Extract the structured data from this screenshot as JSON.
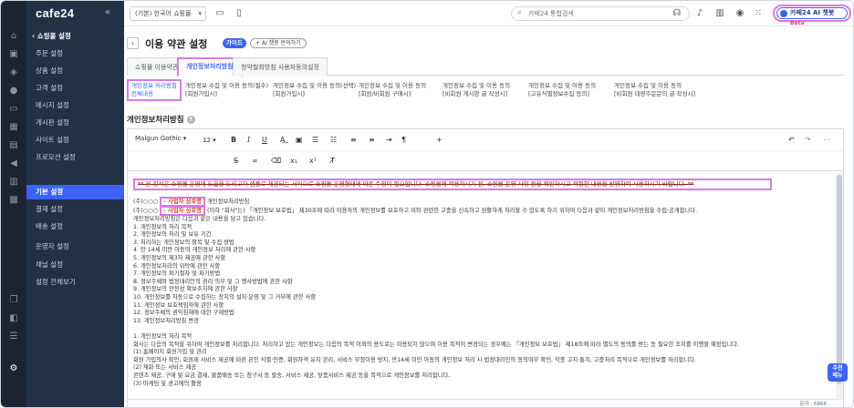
{
  "brand": {
    "logo": "cafe24",
    "collapse": "«"
  },
  "rail": {
    "icons": [
      "home-icon",
      "box-icon",
      "tag-icon",
      "user-icon",
      "message-icon",
      "grid-icon",
      "monitor-icon",
      "megaphone-icon",
      "chart-icon",
      "apps-icon",
      "layers-icon",
      "puzzle-icon",
      "list-icon",
      "gear-icon"
    ]
  },
  "menu": {
    "back": "‹ 쇼핑몰 설정",
    "items": [
      "주문 설정",
      "상품 설정",
      "고객 설정",
      "메시지 설정",
      "게시판 설정",
      "사이트 설정",
      "프로모션 설정",
      "기본 설정",
      "결제 설정",
      "배송 설정",
      "운영자 설정",
      "채널 설정",
      "설정 전체보기"
    ],
    "active_index": 7
  },
  "topbar": {
    "shop_select": "(기본) 한국어 쇼핑몰",
    "search_placeholder": "카페24 통합검색",
    "ai_label": "카페24 AI 챗봇",
    "ai_beta": "Beta"
  },
  "page": {
    "title": "이용 약관 설정",
    "guide": "가이드",
    "ask": "+ AI 챗봇 문의하기"
  },
  "tabs": [
    "쇼핑몰 이용약관",
    "개인정보처리방침",
    "청약철회방침 사용자동의설정"
  ],
  "subnav": [
    [
      "개인정보 처리방침",
      "전체내용"
    ],
    [
      "개인정보 수집 및 이용 동의(필수)",
      "[회원가입시]"
    ],
    [
      "개인정보 수집 및 이용 동의(선택)",
      "[회원가입시]"
    ],
    [
      "개인정보 수집 및 이용 동의",
      "[회원/비회원 구매시]"
    ],
    [
      "개인정보 수집 및 이용 동의",
      "[비회원 게시판 글 작성시]"
    ],
    [
      "개인정보 수집 및 이용 동의",
      "[고유식별정보수집 동의]"
    ],
    [
      "개인정보 수집 및 이용 동의",
      "[비회원 대량주문문의 글 작성시]"
    ]
  ],
  "section_title": "개인정보처리방침",
  "editor": {
    "font": "Malgun Gothic",
    "size": "12",
    "notice": "** 본 양식은 쇼핑몰 운영에 도움을 드리고자 샘플로 제공되는 서식으로 쇼핑몰 운영형태에 따른 수정이 필요합니다. 쇼핑몰에 적용하시기 전, 쇼핑몰 운영 사항 등을 확인하시고 적절한 내용을 반영하여 사용하시기 바랍니다. **",
    "pill_text": "- 사업자 상호명",
    "line1_prefix": "(주)○○○",
    "line1_suffix": "개인정보처리방침",
    "line2_prefix": "(주)○○○",
    "line2_suffix": "(이하 \"회사\"는) 「개인정보 보호법」 제30조에 따라 이용자의 개인정보를 보호하고 이와 관련한 고충을 신속하고 원활하게 처리할 수 있도록 하기 위하여 다음과 같이 개인정보처리방침을 수립·공개합니다.",
    "lines": [
      "개인정보처리방침은 다음과 같은 내용을 담고 있습니다.",
      "1. 개인정보의 처리 목적",
      "2. 개인정보의 처리 및 보유 기간",
      "3. 처리하는 개인정보의 항목 및 수집 방법",
      "4. 만 14세 미만 아동의 개인정보 처리에 관한 사항",
      "5. 개인정보의 제3자 제공에 관한 사항",
      "6. 개인정보처리의 위탁에 관한 사항",
      "7. 개인정보의 파기절차 및 파기방법",
      "8. 정보주체와 법정대리인의 권리·의무 및 그 행사방법에 관한 사항",
      "9. 개인정보의 안전성 확보조치에 관한 사항",
      "10. 개인정보를 자동으로 수집하는 장치의 설치·운영 및 그 거부에 관한 사항",
      "11. 개인정보 보호책임자에 관한 사항",
      "12. 정보주체의 권익침해에 대한 구제방법",
      "13. 개인정보처리방침 변경",
      "",
      "1. 개인정보의 처리 목적",
      "회사는 다음의 목적을 위하여 개인정보를 처리합니다. 처리하고 있는 개인정보는 다음의 목적 이외의 용도로는 이용되지 않으며 이용 목적이 변경되는 경우에는 「개인정보 보호법」 제18조에 따라 별도의 동의를 받는 등 필요한 조치를 이행할 예정입니다.",
      "(1) 홈페이지 회원가입 및 관리",
      "회원 가입의사 확인, 회원제 서비스 제공에 따른 본인 식별·인증, 회원자격 유지·관리, 서비스 부정이용 방지, 만14세 미만 아동의 개인정보 처리 시 법정대리인의 동의여부 확인, 각종 고지·통지, 고충처리 목적으로 개인정보를 처리합니다.",
      "(2) 재화 또는 서비스 제공",
      "콘텐츠 제공, 구매 및 요금 결제, 물품배송 또는 청구서 등 발송, 서비스 제공, 맞춤서비스 제공 등을 목적으로 개인정보를 처리합니다.",
      "(3) 마케팅 및 광고에의 활용"
    ],
    "status": "문자 : 6866"
  },
  "fab": [
    "추천",
    "메뉴"
  ]
}
